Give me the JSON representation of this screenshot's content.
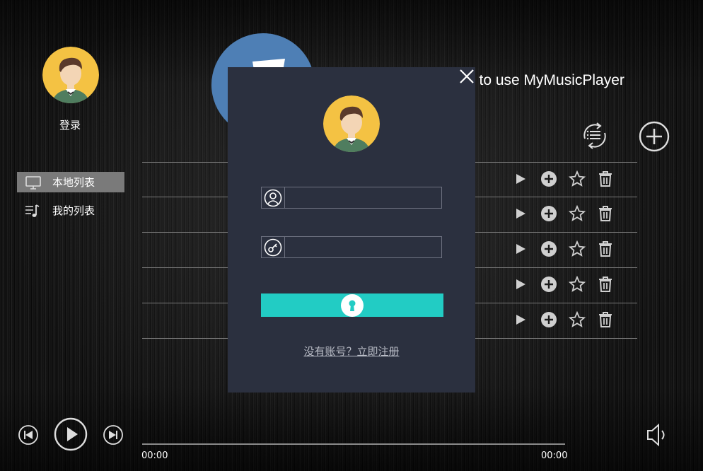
{
  "sidebar": {
    "login_label": "登录",
    "items": [
      {
        "label": "本地列表",
        "icon": "monitor-icon",
        "active": true
      },
      {
        "label": "我的列表",
        "icon": "playlist-music-icon",
        "active": false
      }
    ]
  },
  "header": {
    "welcome_visible": "e to use MyMusicPlayer"
  },
  "toolbar": {
    "loop_icon": "loop-list-icon",
    "add_icon": "add-circle-icon"
  },
  "song_rows": [
    {
      "actions": [
        "play-icon",
        "add-icon",
        "star-icon",
        "trash-icon"
      ]
    },
    {
      "actions": [
        "play-icon",
        "add-icon",
        "star-icon",
        "trash-icon"
      ]
    },
    {
      "actions": [
        "play-icon",
        "add-icon",
        "star-icon",
        "trash-icon"
      ]
    },
    {
      "actions": [
        "play-icon",
        "add-icon",
        "star-icon",
        "trash-icon"
      ]
    },
    {
      "actions": [
        "play-icon",
        "add-icon",
        "star-icon",
        "trash-icon"
      ]
    }
  ],
  "login_modal": {
    "username": {
      "value": "",
      "placeholder": ""
    },
    "password": {
      "value": "",
      "placeholder": ""
    },
    "register_link": "没有账号？立即注册",
    "accent_color": "#22ccc4"
  },
  "player": {
    "current_time": "00:00",
    "total_time": "00:00",
    "progress": 0
  },
  "colors": {
    "modal_bg": "#2b303f",
    "accent": "#22ccc4",
    "album_blue": "#4e7fb5",
    "avatar_yellow": "#f4c243"
  }
}
